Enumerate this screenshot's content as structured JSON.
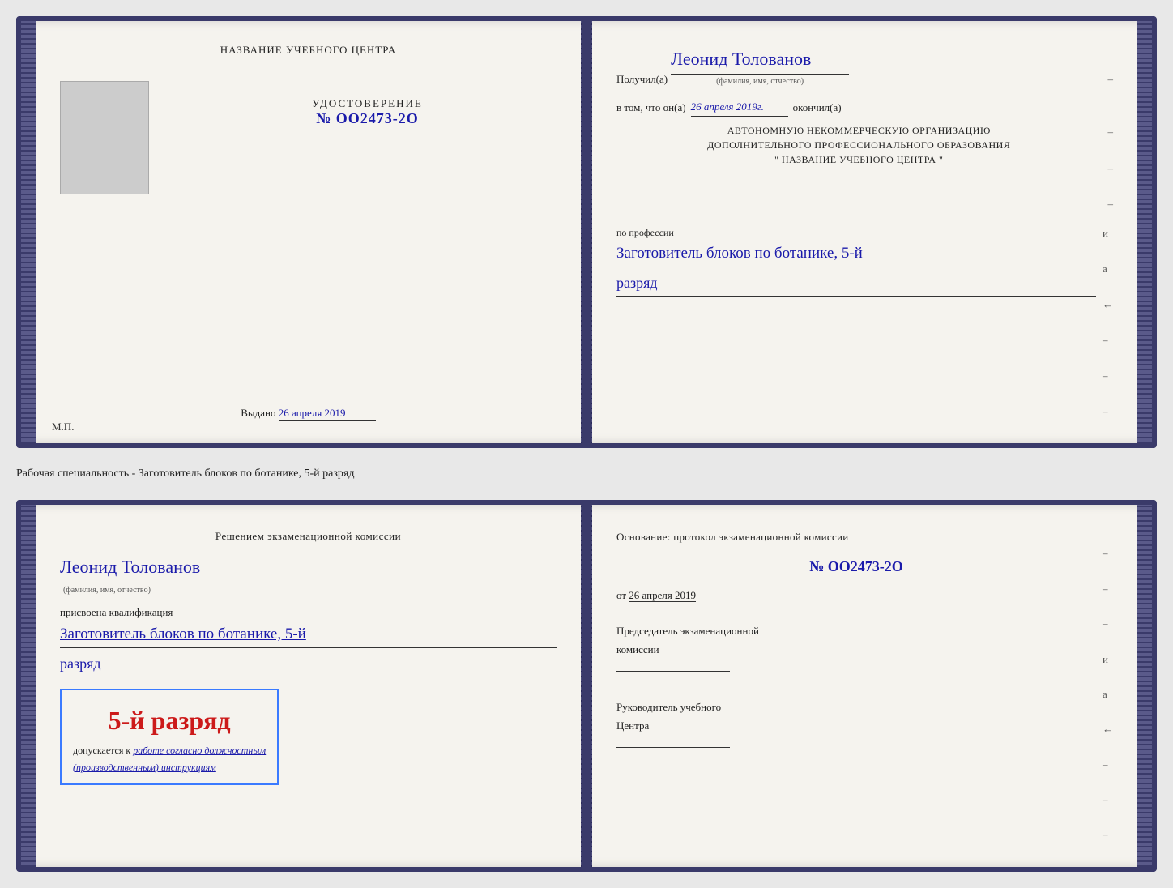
{
  "card1": {
    "left": {
      "center_title": "НАЗВАНИЕ УЧЕБНОГО ЦЕНТРА",
      "udost_title": "УДОСТОВЕРЕНИЕ",
      "udost_number": "№ OO2473-2O",
      "vydano_label": "Выдано",
      "vydano_date": "26 апреля 2019",
      "mp_label": "М.П."
    },
    "right": {
      "poluchil": "Получил(а)",
      "name": "Леонид Толованов",
      "fio_note": "(фамилия, имя, отчество)",
      "vtom_text": "в том, что он(а)",
      "vtom_date": "26 апреля 2019г.",
      "okonchil": "окончил(а)",
      "block_line1": "АВТОНОМНУЮ НЕКОММЕРЧЕСКУЮ ОРГАНИЗАЦИЮ",
      "block_line2": "ДОПОЛНИТЕЛЬНОГО ПРОФЕССИОНАЛЬНОГО ОБРАЗОВАНИЯ",
      "block_line3": "\"   НАЗВАНИЕ УЧЕБНОГО ЦЕНТРА   \"",
      "po_professii": "по профессии",
      "qualification": "Заготовитель блоков по ботанике, 5-й",
      "razryad": "разряд",
      "dash1": "–",
      "dash2": "–",
      "dash3": "–",
      "i_label": "и",
      "a_label": "а",
      "arrow_label": "←"
    }
  },
  "separator": {
    "text": "Рабочая специальность - Заготовитель блоков по ботанике, 5-й разряд"
  },
  "card2": {
    "left": {
      "resheniem_title": "Решением экзаменационной комиссии",
      "name": "Леонид Толованов",
      "fio_note": "(фамилия, имя, отчество)",
      "prisvoena": "присвоена квалификация",
      "qualification": "Заготовитель блоков по ботанике, 5-й",
      "razryad": "разряд",
      "badge_number": "5-й разряд",
      "dopuskaetsya": "допускается к",
      "dopusk_italic": "работе согласно должностным",
      "dopusk_italic2": "(производственным) инструкциям"
    },
    "right": {
      "osnovanie": "Основание: протокол экзаменационной комиссии",
      "number": "№  OO2473-2O",
      "ot_label": "от",
      "ot_date": "26 апреля 2019",
      "predsedatel_line1": "Председатель экзаменационной",
      "predsedatel_line2": "комиссии",
      "rukovoditel_line1": "Руководитель учебного",
      "rukovoditel_line2": "Центра",
      "dash1": "–",
      "dash2": "–",
      "dash3": "–",
      "i_label": "и",
      "a_label": "а",
      "arrow_label": "←"
    }
  }
}
